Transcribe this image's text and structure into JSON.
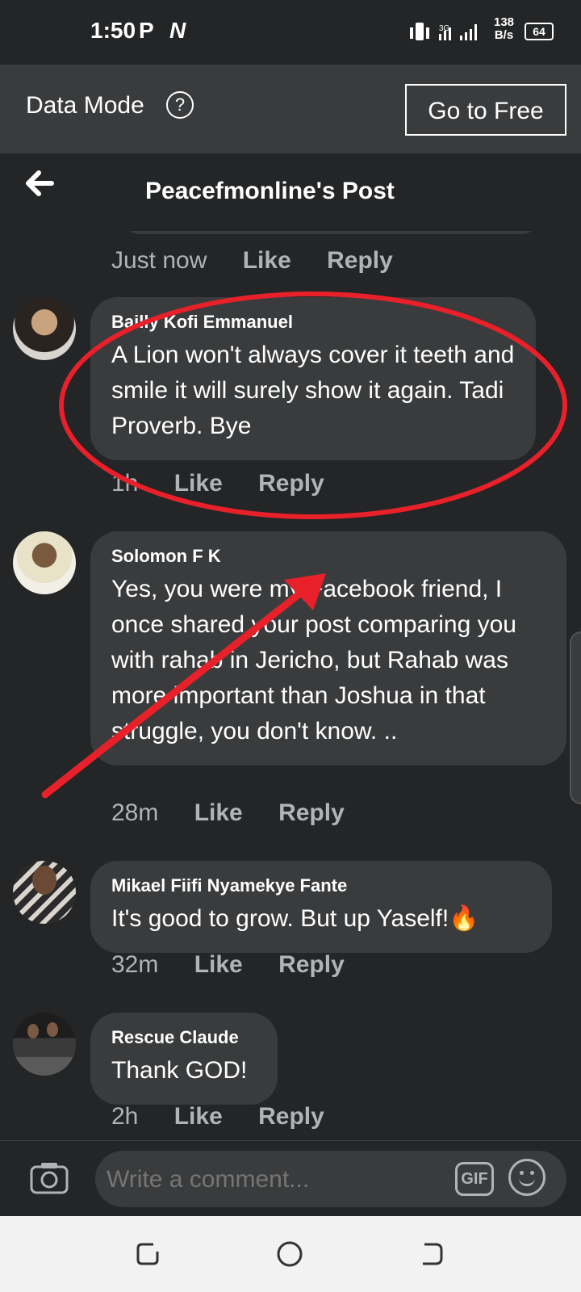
{
  "status_bar": {
    "time": "1:50",
    "app_icons": [
      "P",
      "N"
    ],
    "speed_value": "138",
    "speed_unit": "B/s",
    "battery": "64"
  },
  "data_mode": {
    "label": "Data Mode",
    "help_icon": "?",
    "button_label": "Go to Free"
  },
  "header": {
    "title": "Peacefmonline's Post"
  },
  "first_meta": {
    "time": "Just now",
    "like": "Like",
    "reply": "Reply"
  },
  "comments": [
    {
      "name": "Bailly Kofi Emmanuel",
      "text": "A Lion won't always cover it teeth and smile it will surely show it again. Tadi Proverb. Bye",
      "time": "1h",
      "like": "Like",
      "reply": "Reply"
    },
    {
      "name": "Solomon F K",
      "text": "Yes, you were my Facebook friend, I once shared your post comparing you with rahab in Jericho, but Rahab was more important than Joshua in that struggle, you don't know. ..",
      "time": "28m",
      "like": "Like",
      "reply": "Reply"
    },
    {
      "name": "Mikael Fiifi Nyamekye Fante",
      "text": "It's good to grow. But up Yaself!🔥",
      "time": "32m",
      "like": "Like",
      "reply": "Reply"
    },
    {
      "name": "Rescue Claude",
      "text": "Thank GOD!",
      "time": "2h",
      "like": "Like",
      "reply": "Reply"
    }
  ],
  "composer": {
    "placeholder": "Write a comment...",
    "gif_label": "GIF"
  },
  "annotation_color": "#e8202a",
  "colors": {
    "background": "#242526",
    "bubble": "#3a3b3c",
    "meta_text": "#b0b3b8"
  }
}
